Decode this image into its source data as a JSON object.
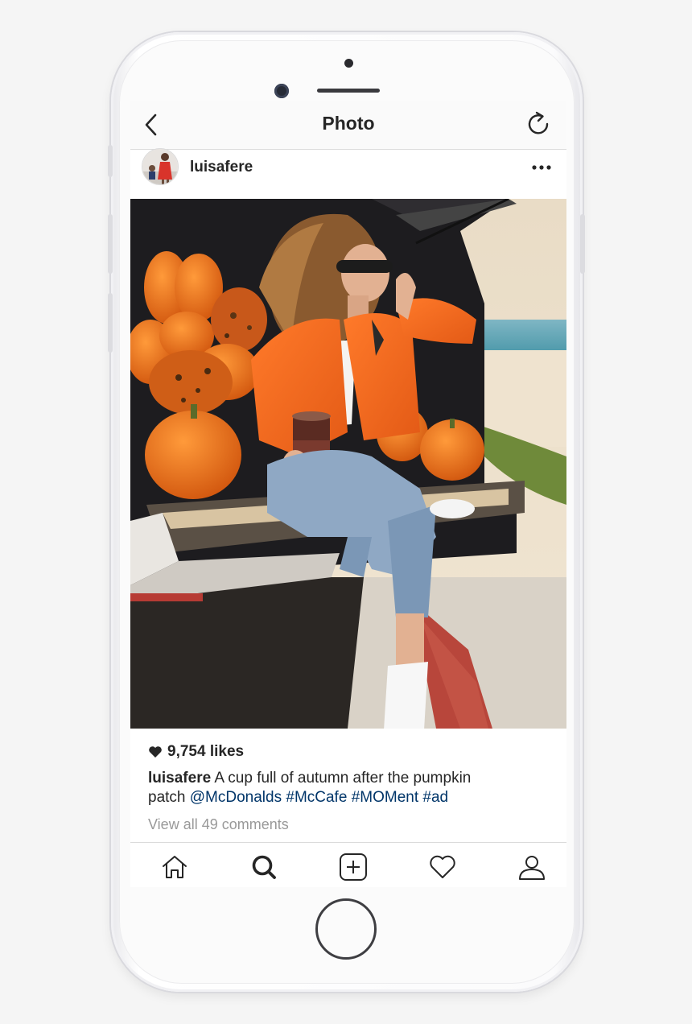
{
  "navbar": {
    "title": "Photo",
    "back_icon": "chevron-left-icon",
    "refresh_icon": "refresh-icon"
  },
  "post": {
    "username": "luisafere",
    "more_icon": "more-horizontal-icon",
    "likes": {
      "icon": "heart-filled-icon",
      "text": "9,754 likes"
    },
    "caption": {
      "username": "luisafere",
      "text_line1": "A cup full of autumn after the pumpkin",
      "text_line2": "patch",
      "tags": [
        "@McDonalds",
        "#McCafe",
        "#MOMent",
        "#ad"
      ]
    },
    "view_comments": "View all 49 comments"
  },
  "tabbar": {
    "items": [
      {
        "name": "home",
        "icon": "home-icon"
      },
      {
        "name": "search",
        "icon": "search-icon"
      },
      {
        "name": "new-post",
        "icon": "add-square-icon"
      },
      {
        "name": "activity",
        "icon": "heart-outline-icon"
      },
      {
        "name": "profile",
        "icon": "user-icon"
      }
    ]
  },
  "colors": {
    "text": "#262626",
    "link": "#003569",
    "muted": "#999999",
    "border": "#dbdbdb",
    "navbar_bg": "#fafafa"
  }
}
